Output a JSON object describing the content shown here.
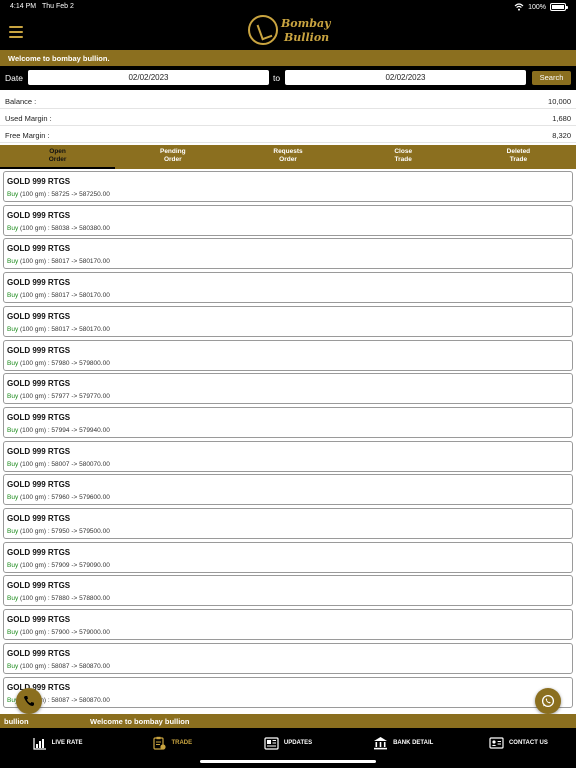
{
  "status_bar": {
    "time": "4:14 PM",
    "date": "Thu Feb 2",
    "battery": "100%"
  },
  "header": {
    "logo_line1": "Bombay",
    "logo_line2": "Bullion"
  },
  "welcome_text": "Welcome to bombay bullion.",
  "filter": {
    "date_label": "Date",
    "from_value": "02/02/2023",
    "to_label": "to",
    "to_value": "02/02/2023",
    "search_label": "Search"
  },
  "balances": [
    {
      "label": "Balance :",
      "value": "10,000"
    },
    {
      "label": "Used Margin :",
      "value": "1,680"
    },
    {
      "label": "Free Margin :",
      "value": "8,320"
    }
  ],
  "tabs": [
    {
      "line1": "Open",
      "line2": "Order",
      "active": true
    },
    {
      "line1": "Pending",
      "line2": "Order",
      "active": false
    },
    {
      "line1": "Requests",
      "line2": "Order",
      "active": false
    },
    {
      "line1": "Close",
      "line2": "Trade",
      "active": false
    },
    {
      "line1": "Deleted",
      "line2": "Trade",
      "active": false
    }
  ],
  "orders": [
    {
      "name": "GOLD 999 RTGS",
      "side": "Buy",
      "detail": " (100 gm) : 58725 -> 587250.00"
    },
    {
      "name": "GOLD 999 RTGS",
      "side": "Buy",
      "detail": " (100 gm) : 58038 -> 580380.00"
    },
    {
      "name": "GOLD 999 RTGS",
      "side": "Buy",
      "detail": " (100 gm) : 58017 -> 580170.00"
    },
    {
      "name": "GOLD 999 RTGS",
      "side": "Buy",
      "detail": " (100 gm) : 58017 -> 580170.00"
    },
    {
      "name": "GOLD 999 RTGS",
      "side": "Buy",
      "detail": " (100 gm) : 58017 -> 580170.00"
    },
    {
      "name": "GOLD 999 RTGS",
      "side": "Buy",
      "detail": " (100 gm) : 57980 -> 579800.00"
    },
    {
      "name": "GOLD 999 RTGS",
      "side": "Buy",
      "detail": " (100 gm) : 57977 -> 579770.00"
    },
    {
      "name": "GOLD 999 RTGS",
      "side": "Buy",
      "detail": " (100 gm) : 57994 -> 579940.00"
    },
    {
      "name": "GOLD 999 RTGS",
      "side": "Buy",
      "detail": " (100 gm) : 58007 -> 580070.00"
    },
    {
      "name": "GOLD 999 RTGS",
      "side": "Buy",
      "detail": " (100 gm) : 57960 -> 579600.00"
    },
    {
      "name": "GOLD 999 RTGS",
      "side": "Buy",
      "detail": " (100 gm) : 57950 -> 579500.00"
    },
    {
      "name": "GOLD 999 RTGS",
      "side": "Buy",
      "detail": " (100 gm) : 57909 -> 579090.00"
    },
    {
      "name": "GOLD 999 RTGS",
      "side": "Buy",
      "detail": " (100 gm) : 57880 -> 578800.00"
    },
    {
      "name": "GOLD 999 RTGS",
      "side": "Buy",
      "detail": " (100 gm) : 57900 -> 579000.00"
    },
    {
      "name": "GOLD 999 RTGS",
      "side": "Buy",
      "detail": " (100 gm) : 58087 -> 580870.00"
    },
    {
      "name": "GOLD 999 RTGS",
      "side": "Buy",
      "detail": " (100 gm) : 58087 -> 580870.00"
    }
  ],
  "ticker": {
    "text1": "bullion",
    "text2": "Welcome to bombay bullion"
  },
  "nav": [
    {
      "label": "LIVE RATE",
      "icon": "chart-icon",
      "active": false
    },
    {
      "label": "TRADE",
      "icon": "trade-icon",
      "active": true
    },
    {
      "label": "UPDATES",
      "icon": "newspaper-icon",
      "active": false
    },
    {
      "label": "BANK DETAIL",
      "icon": "bank-icon",
      "active": false
    },
    {
      "label": "CONTACT US",
      "icon": "contact-card-icon",
      "active": false
    }
  ],
  "colors": {
    "accent": "#8b6f1f",
    "gold": "#c9a440",
    "buy": "#1a8a1a",
    "header_bg": "#000000"
  }
}
